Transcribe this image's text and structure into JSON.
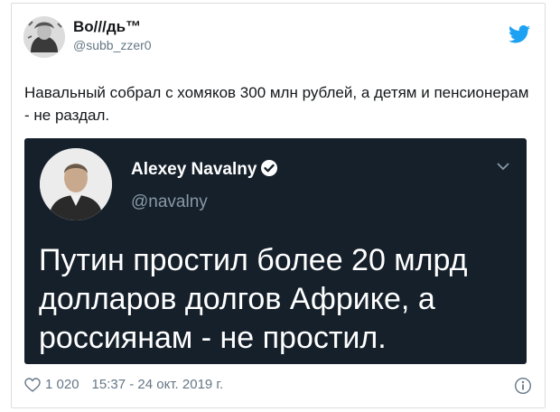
{
  "tweet": {
    "author_name": "Во///дь™",
    "author_handle": "@subb_zzer0",
    "text": "Навальный собрал с хомяков 300 млн рублей, а детям и пенсионерам - не раздал.",
    "likes": "1 020",
    "timestamp": "15:37 - 24 окт. 2019 г."
  },
  "embedded": {
    "author_name": "Alexey Navalny",
    "author_handle": "@navalny",
    "text": "Путин простил более 20 млрд долларов долгов Африке, а россиянам - не простил."
  },
  "colors": {
    "twitter_blue": "#1da1f2",
    "embed_bg": "#15202b",
    "muted": "#657786"
  },
  "icons": [
    "twitter-bird-icon",
    "verified-badge-icon",
    "chevron-down-icon",
    "heart-icon",
    "info-icon"
  ]
}
